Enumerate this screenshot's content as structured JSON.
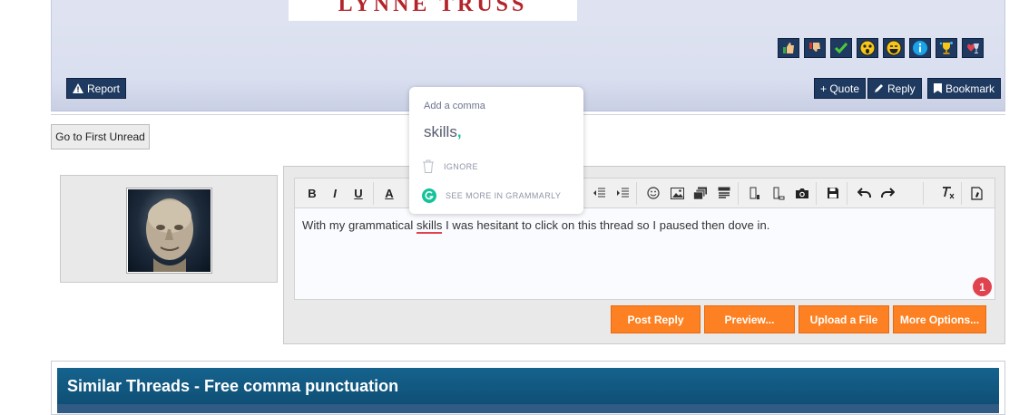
{
  "post": {
    "book_author": "LYNNE TRUSS",
    "reactions": [
      "thumbs-up-icon",
      "thumbs-down-icon",
      "check-icon",
      "shocked-face-icon",
      "laughing-face-icon",
      "info-icon",
      "trophy-icon",
      "heart-wine-icon"
    ],
    "report_label": "Report",
    "quote_label": "+ Quote",
    "reply_label": "Reply",
    "bookmark_label": "Bookmark"
  },
  "first_unread_label": "Go to First Unread",
  "editor": {
    "text_before": "With my grammatical ",
    "misspelled_word": "skills",
    "text_after": " I was hesitant to click on this thread so I paused then dove in.",
    "grammarly_count": "1",
    "buttons": {
      "post_reply": "Post Reply",
      "preview": "Preview...",
      "upload": "Upload a File",
      "more": "More Options..."
    }
  },
  "grammarly": {
    "title": "Add a comma",
    "suggestion_word": "skills",
    "suggestion_punct": ",",
    "ignore_label": "IGNORE",
    "see_more_label": "SEE MORE IN GRAMMARLY"
  },
  "similar_threads": {
    "title": "Similar Threads - Free comma punctuation"
  },
  "colors": {
    "orange": "#fd8122",
    "navy": "#1f3a60",
    "grammarly_green": "#15c39a",
    "error_red": "#e0424e"
  }
}
